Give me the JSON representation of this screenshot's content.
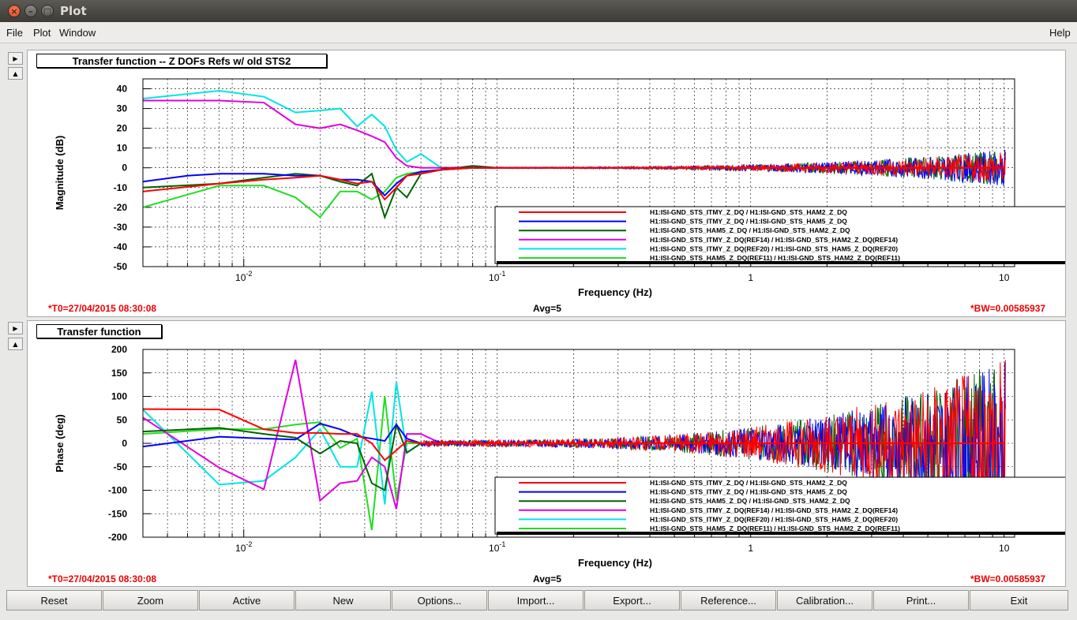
{
  "window": {
    "title": "Plot"
  },
  "menu": {
    "file": "File",
    "plot": "Plot",
    "window": "Window",
    "help": "Help"
  },
  "side_buttons": {
    "expand": "▶",
    "collapse": "▲"
  },
  "colors": {
    "red": "#ff0000",
    "blue": "#0000ff",
    "darkgreen": "#006400",
    "magenta": "#e000e0",
    "cyan": "#00e5e5",
    "green": "#22dd22",
    "annot": "#ee0000"
  },
  "top_panel": {
    "title": "Transfer function -- Z DOFs Refs w/ old STS2",
    "t0": "*T0=27/04/2015 08:30:08",
    "avg": "Avg=5",
    "bw": "*BW=0.00585937"
  },
  "bottom_panel": {
    "title": "Transfer function",
    "t0": "*T0=27/04/2015 08:30:08",
    "avg": "Avg=5",
    "bw": "*BW=0.00585937"
  },
  "buttons": [
    "Reset",
    "Zoom",
    "Active",
    "New",
    "Options...",
    "Import...",
    "Export...",
    "Reference...",
    "Calibration...",
    "Print...",
    "Exit"
  ],
  "chart_data": [
    {
      "type": "line",
      "title": "",
      "xlabel": "Frequency (Hz)",
      "ylabel": "Magnitude (dB)",
      "xscale": "log",
      "xlim": [
        0.004,
        11
      ],
      "ylim": [
        -50,
        45
      ],
      "xticks": [
        {
          "v": 0.01,
          "base": "10",
          "exp": "-2"
        },
        {
          "v": 0.1,
          "base": "10",
          "exp": "-1"
        },
        {
          "v": 1,
          "base": "1",
          "exp": ""
        },
        {
          "v": 10,
          "base": "10",
          "exp": ""
        }
      ],
      "yticks": [
        40,
        30,
        20,
        10,
        0,
        -10,
        -20,
        -30,
        -40,
        -50
      ],
      "grid": true,
      "legend_position": "bottom-right",
      "series": [
        {
          "name": "H1:ISI-GND_STS_ITMY_Z_DQ / H1:ISI-GND_STS_HAM2_Z_DQ",
          "color": "#ff0000",
          "noise_amp": 8,
          "noise_start": 0.06,
          "x": [
            0.004,
            0.008,
            0.012,
            0.016,
            0.02,
            0.024,
            0.028,
            0.032,
            0.036,
            0.04,
            0.044,
            0.05,
            0.06,
            0.08,
            0.1,
            1,
            10
          ],
          "y": [
            -12,
            -8,
            -6,
            -5,
            -4,
            -6,
            -8,
            -7,
            -16,
            -10,
            -4,
            -3,
            -1,
            0,
            0,
            0,
            0
          ]
        },
        {
          "name": "H1:ISI-GND_STS_ITMY_Z_DQ / H1:ISI-GND_STS_HAM5_Z_DQ",
          "color": "#0000ff",
          "noise_amp": 9,
          "noise_start": 0.06,
          "x": [
            0.004,
            0.006,
            0.008,
            0.012,
            0.016,
            0.02,
            0.024,
            0.028,
            0.032,
            0.036,
            0.04,
            0.044,
            0.05,
            0.06,
            0.08,
            0.1,
            1,
            10
          ],
          "y": [
            -7,
            -4,
            -3,
            -3,
            -4,
            -4,
            -6,
            -6,
            -7,
            -14,
            -8,
            -4,
            -2,
            -1,
            0,
            0,
            0,
            0
          ]
        },
        {
          "name": "H1:ISI-GND_STS_HAM5_Z_DQ / H1:ISI-GND_STS_HAM2_Z_DQ",
          "color": "#006400",
          "noise_amp": 9,
          "noise_start": 0.06,
          "x": [
            0.004,
            0.008,
            0.012,
            0.016,
            0.02,
            0.024,
            0.028,
            0.032,
            0.036,
            0.04,
            0.044,
            0.05,
            0.06,
            0.08,
            0.1,
            1,
            10
          ],
          "y": [
            -10,
            -8,
            -5,
            -3,
            -4,
            -7,
            -9,
            -3,
            -25,
            -10,
            -15,
            -3,
            -1,
            1,
            0,
            0,
            0
          ]
        },
        {
          "name": "H1:ISI-GND_STS_ITMY_Z_DQ(REF14) / H1:ISI-GND_STS_HAM2_Z_DQ(REF14)",
          "color": "#e000e0",
          "noise_amp": 0,
          "noise_start": 1,
          "x": [
            0.004,
            0.008,
            0.012,
            0.016,
            0.02,
            0.024,
            0.028,
            0.032,
            0.036,
            0.04,
            0.044,
            0.05,
            0.06,
            0.08,
            0.1
          ],
          "y": [
            34,
            34,
            33,
            22,
            20,
            22,
            19,
            16,
            13,
            5,
            1,
            0,
            0,
            0,
            0
          ]
        },
        {
          "name": "H1:ISI-GND_STS_ITMY_Z_DQ(REF20) / H1:ISI-GND_STS_HAM5_Z_DQ(REF20)",
          "color": "#00e5e5",
          "noise_amp": 0,
          "noise_start": 1,
          "x": [
            0.004,
            0.008,
            0.012,
            0.016,
            0.02,
            0.024,
            0.028,
            0.032,
            0.036,
            0.04,
            0.044,
            0.05,
            0.06,
            0.08,
            0.1
          ],
          "y": [
            35,
            39,
            36,
            28,
            29,
            30,
            21,
            27,
            21,
            9,
            3,
            7,
            0,
            0,
            0
          ]
        },
        {
          "name": "H1:ISI-GND_STS_HAM5_Z_DQ(REF11) / H1:ISI-GND_STS_HAM2_Z_DQ(REF11)",
          "color": "#22dd22",
          "noise_amp": 0,
          "noise_start": 1,
          "x": [
            0.004,
            0.008,
            0.012,
            0.016,
            0.02,
            0.024,
            0.028,
            0.032,
            0.036,
            0.04,
            0.044,
            0.05,
            0.06,
            0.08,
            0.1
          ],
          "y": [
            -20,
            -9,
            -9,
            -15,
            -25,
            -12,
            -12,
            -16,
            -12,
            -5,
            -3,
            -2,
            -1,
            0,
            0
          ]
        }
      ]
    },
    {
      "type": "line",
      "title": "",
      "xlabel": "Frequency (Hz)",
      "ylabel": "Phase (deg)",
      "xscale": "log",
      "xlim": [
        0.004,
        11
      ],
      "ylim": [
        -200,
        200
      ],
      "xticks": [
        {
          "v": 0.01,
          "base": "10",
          "exp": "-2"
        },
        {
          "v": 0.1,
          "base": "10",
          "exp": "-1"
        },
        {
          "v": 1,
          "base": "1",
          "exp": ""
        },
        {
          "v": 10,
          "base": "10",
          "exp": ""
        }
      ],
      "yticks": [
        200,
        150,
        100,
        50,
        0,
        -50,
        -100,
        -150,
        -200
      ],
      "grid": true,
      "legend_position": "bottom-right",
      "series": [
        {
          "name": "H1:ISI-GND_STS_ITMY_Z_DQ / H1:ISI-GND_STS_HAM2_Z_DQ",
          "color": "#ff0000",
          "noise_amp": 180,
          "noise_start": 0.05,
          "x": [
            0.004,
            0.008,
            0.012,
            0.016,
            0.02,
            0.024,
            0.028,
            0.032,
            0.036,
            0.04,
            0.044,
            0.05,
            0.06,
            0.08,
            0.1,
            1,
            10
          ],
          "y": [
            73,
            72,
            30,
            22,
            22,
            20,
            20,
            0,
            -36,
            -15,
            5,
            0,
            0,
            0,
            0,
            0,
            0
          ]
        },
        {
          "name": "H1:ISI-GND_STS_ITMY_Z_DQ / H1:ISI-GND_STS_HAM5_Z_DQ",
          "color": "#0000ff",
          "noise_amp": 170,
          "noise_start": 0.05,
          "x": [
            0.004,
            0.008,
            0.012,
            0.016,
            0.02,
            0.024,
            0.028,
            0.032,
            0.036,
            0.04,
            0.044,
            0.05,
            0.06,
            0.08,
            0.1,
            1,
            10
          ],
          "y": [
            -7,
            14,
            10,
            8,
            42,
            30,
            15,
            10,
            5,
            40,
            10,
            0,
            0,
            0,
            0,
            0,
            0
          ]
        },
        {
          "name": "H1:ISI-GND_STS_HAM5_Z_DQ / H1:ISI-GND_STS_HAM2_Z_DQ",
          "color": "#006400",
          "noise_amp": 175,
          "noise_start": 0.05,
          "x": [
            0.004,
            0.008,
            0.012,
            0.016,
            0.02,
            0.024,
            0.028,
            0.032,
            0.036,
            0.04,
            0.044,
            0.05,
            0.06,
            0.08,
            0.1,
            1,
            10
          ],
          "y": [
            25,
            33,
            20,
            12,
            -22,
            5,
            0,
            -85,
            -100,
            40,
            -20,
            0,
            0,
            0,
            0,
            0,
            0
          ]
        },
        {
          "name": "H1:ISI-GND_STS_ITMY_Z_DQ(REF14) / H1:ISI-GND_STS_HAM2_Z_DQ(REF14)",
          "color": "#e000e0",
          "noise_amp": 0,
          "noise_start": 1,
          "x": [
            0.004,
            0.008,
            0.012,
            0.016,
            0.02,
            0.024,
            0.028,
            0.032,
            0.036,
            0.04,
            0.044,
            0.05,
            0.06,
            0.08,
            0.1
          ],
          "y": [
            55,
            -52,
            -98,
            178,
            -122,
            -85,
            -80,
            -30,
            -50,
            -140,
            20,
            20,
            0,
            0,
            0
          ]
        },
        {
          "name": "H1:ISI-GND_STS_ITMY_Z_DQ(REF20) / H1:ISI-GND_STS_HAM5_Z_DQ(REF20)",
          "color": "#00e5e5",
          "noise_amp": 0,
          "noise_start": 1,
          "x": [
            0.004,
            0.008,
            0.012,
            0.016,
            0.02,
            0.024,
            0.028,
            0.032,
            0.036,
            0.04,
            0.044,
            0.05,
            0.06,
            0.08,
            0.1
          ],
          "y": [
            72,
            -88,
            -80,
            -30,
            30,
            -50,
            -50,
            110,
            -130,
            130,
            -20,
            0,
            0,
            0,
            0
          ]
        },
        {
          "name": "H1:ISI-GND_STS_HAM5_Z_DQ(REF11) / H1:ISI-GND_STS_HAM2_Z_DQ(REF11)",
          "color": "#22dd22",
          "noise_amp": 0,
          "noise_start": 1,
          "x": [
            0.004,
            0.008,
            0.012,
            0.016,
            0.02,
            0.024,
            0.028,
            0.032,
            0.036,
            0.04,
            0.044,
            0.05,
            0.06,
            0.08,
            0.1
          ],
          "y": [
            20,
            30,
            30,
            40,
            45,
            -10,
            10,
            -185,
            100,
            -120,
            0,
            0,
            0,
            0,
            0
          ]
        }
      ]
    }
  ]
}
